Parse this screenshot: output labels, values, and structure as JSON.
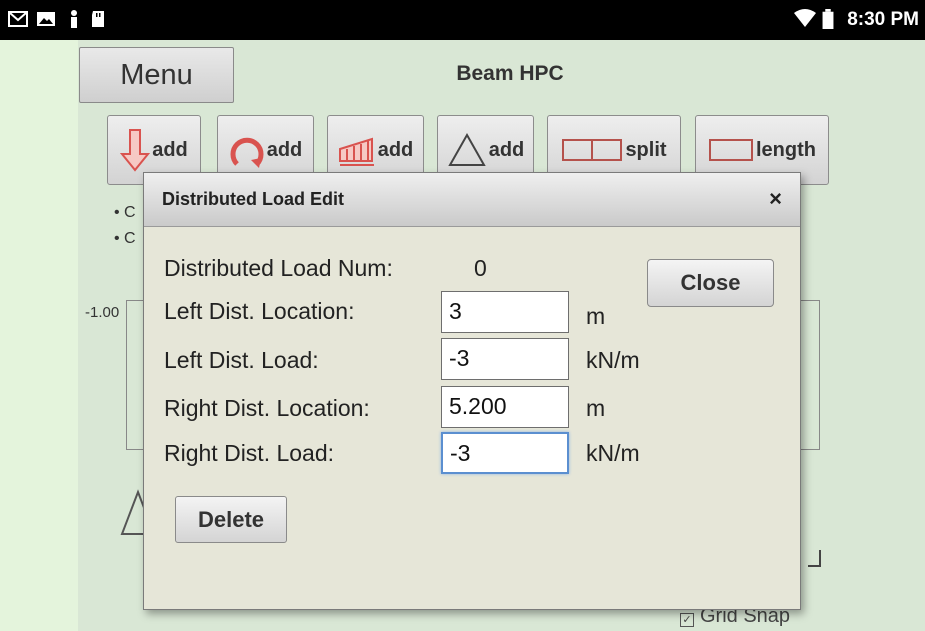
{
  "status_bar": {
    "time": "8:30 PM",
    "icons": [
      "gmail-icon",
      "image-icon",
      "figure-icon",
      "sd-card-icon",
      "wifi-icon",
      "battery-icon"
    ]
  },
  "app": {
    "menu_label": "Menu",
    "title": "Beam HPC",
    "toolbar": [
      {
        "icon": "point-load-icon",
        "label": "add"
      },
      {
        "icon": "moment-load-icon",
        "label": "add"
      },
      {
        "icon": "distributed-load-icon",
        "label": "add"
      },
      {
        "icon": "support-triangle-icon",
        "label": "add"
      },
      {
        "icon": "split-beam-icon",
        "label": "split"
      },
      {
        "icon": "beam-length-icon",
        "label": "length"
      }
    ],
    "bullets": [
      "• C",
      "• C"
    ],
    "axis_left_label": "-1.00",
    "grid_snap_label": "Grid Snap"
  },
  "dialog": {
    "title": "Distributed Load Edit",
    "close_x": "×",
    "num_label": "Distributed Load Num:",
    "num_value": "0",
    "close_label": "Close",
    "delete_label": "Delete",
    "fields": [
      {
        "label": "Left Dist. Location:",
        "value": "3",
        "unit": "m"
      },
      {
        "label": "Left Dist. Load:",
        "value": "-3",
        "unit": "kN/m"
      },
      {
        "label": "Right Dist. Location:",
        "value": "5.200",
        "unit": "m"
      },
      {
        "label": "Right Dist. Load:",
        "value": "-3",
        "unit": "kN/m"
      }
    ]
  },
  "colors": {
    "app_bg": "#d9e7d5",
    "page_bg": "#e4f4dc",
    "dialog_bg": "#e6e6d8",
    "load_red": "#d9534f",
    "focus_blue": "#5b8fd0"
  }
}
